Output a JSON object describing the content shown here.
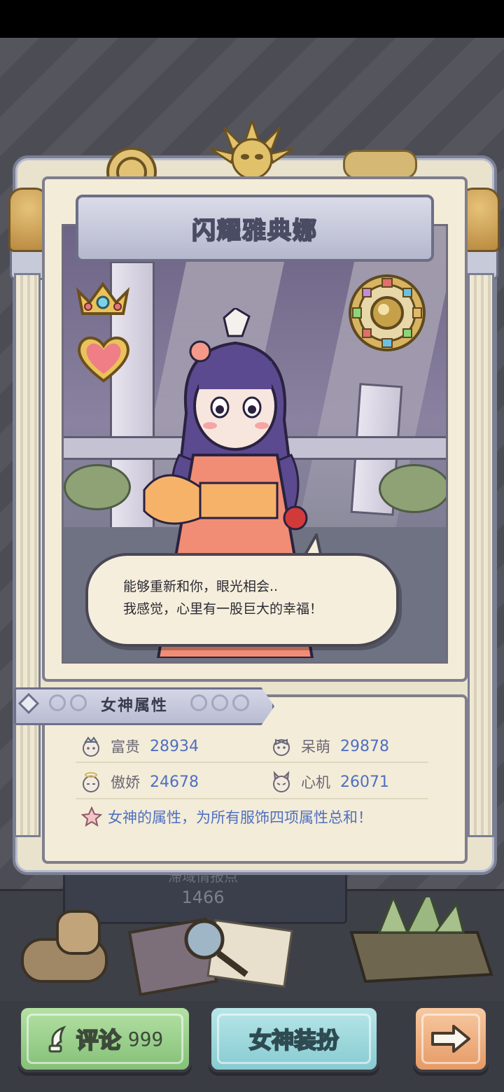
{
  "goddess": {
    "name": "闪耀雅典娜",
    "dialogue": [
      "能够重新和你，眼光相会..",
      "我感觉，心里有一股巨大的幸福！"
    ]
  },
  "attributes": {
    "title": "女神属性",
    "stats": [
      {
        "label": "富贵",
        "value": "28934",
        "icon": "crown-face-icon"
      },
      {
        "label": "呆萌",
        "value": "29878",
        "icon": "bow-face-icon"
      },
      {
        "label": "傲娇",
        "value": "24678",
        "icon": "halo-face-icon"
      },
      {
        "label": "心机",
        "value": "26071",
        "icon": "devil-face-icon"
      }
    ],
    "note": "女神的属性，为所有服饰四项属性总和！"
  },
  "background_board": {
    "label": "滞域情报点",
    "value": "1466"
  },
  "buttons": {
    "comment_label": "评论",
    "comment_count": "999",
    "dress_label": "女神装扮",
    "next_icon": "arrow-right-icon"
  },
  "colors": {
    "stat_value": "#4f6fc2",
    "comment_button": "#9fd28f",
    "dress_button": "#9dd8dc",
    "next_button": "#eeb383"
  }
}
